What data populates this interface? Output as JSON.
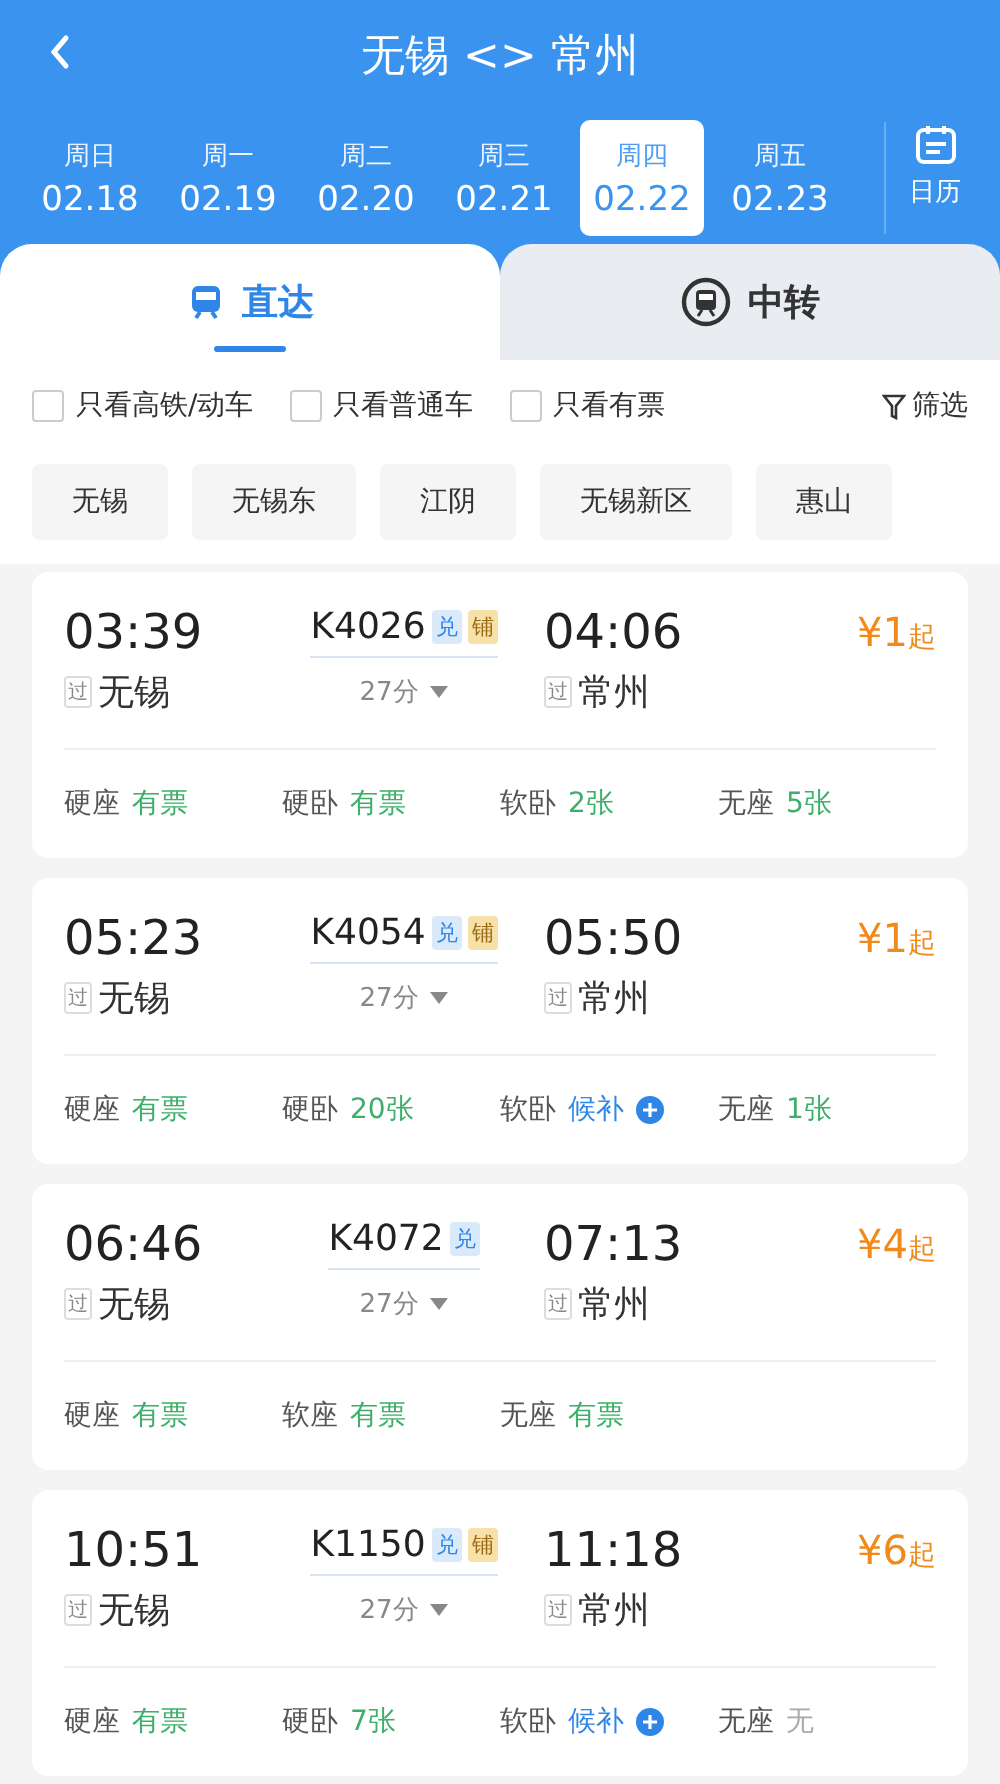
{
  "header": {
    "title": "无锡 <> 常州"
  },
  "dates": [
    {
      "weekday": "周日",
      "date": "02.18",
      "selected": false
    },
    {
      "weekday": "周一",
      "date": "02.19",
      "selected": false
    },
    {
      "weekday": "周二",
      "date": "02.20",
      "selected": false
    },
    {
      "weekday": "周三",
      "date": "02.21",
      "selected": false
    },
    {
      "weekday": "周四",
      "date": "02.22",
      "selected": true
    },
    {
      "weekday": "周五",
      "date": "02.23",
      "selected": false
    }
  ],
  "calendar_label": "日历",
  "tabs": [
    {
      "label": "直达",
      "kind": "direct",
      "selected": true
    },
    {
      "label": "中转",
      "kind": "transfer",
      "selected": false
    }
  ],
  "filters": [
    {
      "label": "只看高铁/动车",
      "checked": false
    },
    {
      "label": "只看普通车",
      "checked": false
    },
    {
      "label": "只看有票",
      "checked": false
    }
  ],
  "filter_button": "筛选",
  "stations": [
    {
      "label": "无锡"
    },
    {
      "label": "无锡东"
    },
    {
      "label": "江阴"
    },
    {
      "label": "无锡新区"
    },
    {
      "label": "惠山"
    }
  ],
  "trains": [
    {
      "depart_time": "03:39",
      "train_no": "K4026",
      "badges": [
        {
          "label": "兑",
          "kind": "exchange"
        },
        {
          "label": "铺",
          "kind": "berth"
        }
      ],
      "arrive_time": "04:06",
      "price": "¥1",
      "price_suffix": "起",
      "depart_tag": "过",
      "depart_station": "无锡",
      "duration": "27分",
      "arrive_tag": "过",
      "arrive_station": "常州",
      "seats": [
        {
          "label": "硬座",
          "status": "有票",
          "kind": "available"
        },
        {
          "label": "硬卧",
          "status": "有票",
          "kind": "available"
        },
        {
          "label": "软卧",
          "status": "2张",
          "kind": "available"
        },
        {
          "label": "无座",
          "status": "5张",
          "kind": "available"
        }
      ]
    },
    {
      "depart_time": "05:23",
      "train_no": "K4054",
      "badges": [
        {
          "label": "兑",
          "kind": "exchange"
        },
        {
          "label": "铺",
          "kind": "berth"
        }
      ],
      "arrive_time": "05:50",
      "price": "¥1",
      "price_suffix": "起",
      "depart_tag": "过",
      "depart_station": "无锡",
      "duration": "27分",
      "arrive_tag": "过",
      "arrive_station": "常州",
      "seats": [
        {
          "label": "硬座",
          "status": "有票",
          "kind": "available"
        },
        {
          "label": "硬卧",
          "status": "20张",
          "kind": "available"
        },
        {
          "label": "软卧",
          "status": "候补",
          "kind": "waitlist"
        },
        {
          "label": "无座",
          "status": "1张",
          "kind": "available"
        }
      ]
    },
    {
      "depart_time": "06:46",
      "train_no": "K4072",
      "badges": [
        {
          "label": "兑",
          "kind": "exchange"
        }
      ],
      "arrive_time": "07:13",
      "price": "¥4",
      "price_suffix": "起",
      "depart_tag": "过",
      "depart_station": "无锡",
      "duration": "27分",
      "arrive_tag": "过",
      "arrive_station": "常州",
      "seats": [
        {
          "label": "硬座",
          "status": "有票",
          "kind": "available"
        },
        {
          "label": "软座",
          "status": "有票",
          "kind": "available"
        },
        {
          "label": "无座",
          "status": "有票",
          "kind": "available"
        }
      ]
    },
    {
      "depart_time": "10:51",
      "train_no": "K1150",
      "badges": [
        {
          "label": "兑",
          "kind": "exchange"
        },
        {
          "label": "铺",
          "kind": "berth"
        }
      ],
      "arrive_time": "11:18",
      "price": "¥6",
      "price_suffix": "起",
      "depart_tag": "过",
      "depart_station": "无锡",
      "duration": "27分",
      "arrive_tag": "过",
      "arrive_station": "常州",
      "seats": [
        {
          "label": "硬座",
          "status": "有票",
          "kind": "available"
        },
        {
          "label": "硬卧",
          "status": "7张",
          "kind": "available"
        },
        {
          "label": "软卧",
          "status": "候补",
          "kind": "waitlist"
        },
        {
          "label": "无座",
          "status": "无",
          "kind": "none"
        }
      ]
    }
  ]
}
